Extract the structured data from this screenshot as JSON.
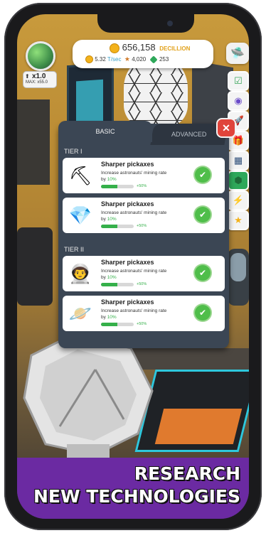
{
  "hud": {
    "currency_amount": "656,158",
    "currency_unit": "DECILLION",
    "rate": "5.32",
    "rate_unit": "T/sec",
    "stars": "4,020",
    "gems": "253",
    "multiplier": "x1.0",
    "multiplier_max": "MAX: x55.0"
  },
  "side_buttons": [
    "ufo-icon",
    "tasks-icon",
    "portal-icon",
    "rocket-icon",
    "gift-icon",
    "solar-panel-icon",
    "gem-icon",
    "lightning-icon",
    "star-icon"
  ],
  "panel": {
    "tabs": [
      "BASIC",
      "ADVANCED"
    ],
    "close_label": "✕",
    "tiers": [
      {
        "label": "TIER I",
        "items": [
          {
            "icon": "pickaxe-icon",
            "title": "Sharper pickaxes",
            "desc": "Increase astronauts' mining rate",
            "by": "by",
            "value": "10%",
            "progress": "+50%",
            "fill": 0.5
          },
          {
            "icon": "crystal-icon",
            "title": "Sharper pickaxes",
            "desc": "Increase astronauts' mining rate",
            "by": "by",
            "value": "10%",
            "progress": "+50%",
            "fill": 0.5
          }
        ]
      },
      {
        "label": "TIER II",
        "items": [
          {
            "icon": "astronaut-icon",
            "title": "Sharper pickaxes",
            "desc": "Increase astronauts' mining rate",
            "by": "by",
            "value": "10%",
            "progress": "+50%",
            "fill": 0.5
          },
          {
            "icon": "planet-icon",
            "title": "Sharper pickaxes",
            "desc": "Increase astronauts' mining rate",
            "by": "by",
            "value": "10%",
            "progress": "+50%",
            "fill": 0.5
          }
        ]
      }
    ]
  },
  "promo": {
    "line1": "RESEARCH",
    "line2": "NEW TECHNOLOGIES"
  },
  "colors": {
    "accent_green": "#35b04a",
    "panel_bg": "#3b4654",
    "promo_bg": "#6b2aa2",
    "close_red": "#e0443b"
  }
}
